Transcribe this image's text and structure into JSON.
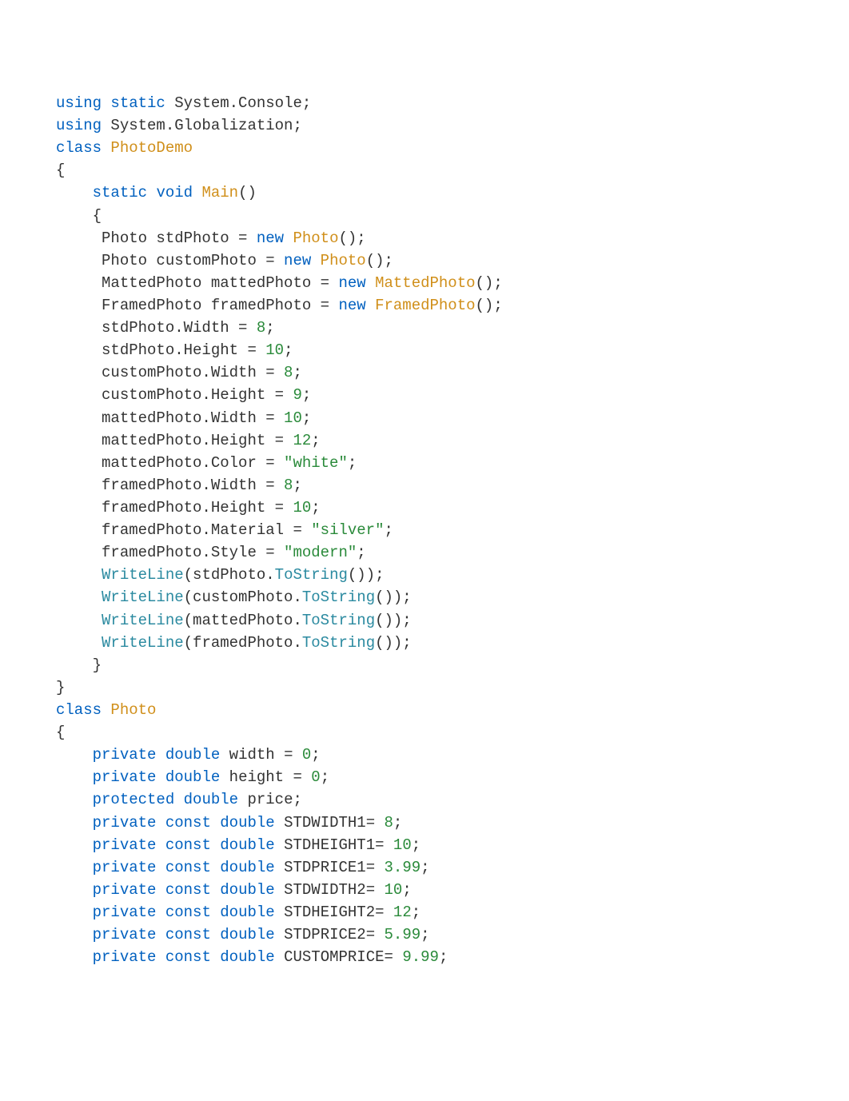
{
  "code": {
    "lines": [
      {
        "segments": [
          {
            "t": "using",
            "c": "kw"
          },
          {
            "t": " ",
            "c": "txt"
          },
          {
            "t": "static",
            "c": "kw"
          },
          {
            "t": " System.Console;",
            "c": "txt"
          }
        ]
      },
      {
        "segments": [
          {
            "t": "using",
            "c": "kw"
          },
          {
            "t": " System.Globalization;",
            "c": "txt"
          }
        ]
      },
      {
        "segments": [
          {
            "t": "class",
            "c": "kw"
          },
          {
            "t": " ",
            "c": "txt"
          },
          {
            "t": "PhotoDemo",
            "c": "type"
          }
        ]
      },
      {
        "segments": [
          {
            "t": "{",
            "c": "txt"
          }
        ]
      },
      {
        "segments": [
          {
            "t": "    ",
            "c": "txt"
          },
          {
            "t": "static",
            "c": "kw"
          },
          {
            "t": " ",
            "c": "txt"
          },
          {
            "t": "void",
            "c": "kw"
          },
          {
            "t": " ",
            "c": "txt"
          },
          {
            "t": "Main",
            "c": "method"
          },
          {
            "t": "()",
            "c": "txt"
          }
        ]
      },
      {
        "segments": [
          {
            "t": "    {",
            "c": "txt"
          }
        ]
      },
      {
        "segments": [
          {
            "t": "     Photo stdPhoto = ",
            "c": "txt"
          },
          {
            "t": "new",
            "c": "kw"
          },
          {
            "t": " ",
            "c": "txt"
          },
          {
            "t": "Photo",
            "c": "type"
          },
          {
            "t": "();",
            "c": "txt"
          }
        ]
      },
      {
        "segments": [
          {
            "t": "     Photo customPhoto = ",
            "c": "txt"
          },
          {
            "t": "new",
            "c": "kw"
          },
          {
            "t": " ",
            "c": "txt"
          },
          {
            "t": "Photo",
            "c": "type"
          },
          {
            "t": "();",
            "c": "txt"
          }
        ]
      },
      {
        "segments": [
          {
            "t": "     MattedPhoto mattedPhoto = ",
            "c": "txt"
          },
          {
            "t": "new",
            "c": "kw"
          },
          {
            "t": " ",
            "c": "txt"
          },
          {
            "t": "MattedPhoto",
            "c": "type"
          },
          {
            "t": "();",
            "c": "txt"
          }
        ]
      },
      {
        "segments": [
          {
            "t": "     FramedPhoto framedPhoto = ",
            "c": "txt"
          },
          {
            "t": "new",
            "c": "kw"
          },
          {
            "t": " ",
            "c": "txt"
          },
          {
            "t": "FramedPhoto",
            "c": "type"
          },
          {
            "t": "();",
            "c": "txt"
          }
        ]
      },
      {
        "segments": [
          {
            "t": "     stdPhoto.Width = ",
            "c": "txt"
          },
          {
            "t": "8",
            "c": "num"
          },
          {
            "t": ";",
            "c": "txt"
          }
        ]
      },
      {
        "segments": [
          {
            "t": "     stdPhoto.Height = ",
            "c": "txt"
          },
          {
            "t": "10",
            "c": "num"
          },
          {
            "t": ";",
            "c": "txt"
          }
        ]
      },
      {
        "segments": [
          {
            "t": "     customPhoto.Width = ",
            "c": "txt"
          },
          {
            "t": "8",
            "c": "num"
          },
          {
            "t": ";",
            "c": "txt"
          }
        ]
      },
      {
        "segments": [
          {
            "t": "     customPhoto.Height = ",
            "c": "txt"
          },
          {
            "t": "9",
            "c": "num"
          },
          {
            "t": ";",
            "c": "txt"
          }
        ]
      },
      {
        "segments": [
          {
            "t": "     mattedPhoto.Width = ",
            "c": "txt"
          },
          {
            "t": "10",
            "c": "num"
          },
          {
            "t": ";",
            "c": "txt"
          }
        ]
      },
      {
        "segments": [
          {
            "t": "     mattedPhoto.Height = ",
            "c": "txt"
          },
          {
            "t": "12",
            "c": "num"
          },
          {
            "t": ";",
            "c": "txt"
          }
        ]
      },
      {
        "segments": [
          {
            "t": "     mattedPhoto.Color = ",
            "c": "txt"
          },
          {
            "t": "\"white\"",
            "c": "str"
          },
          {
            "t": ";",
            "c": "txt"
          }
        ]
      },
      {
        "segments": [
          {
            "t": "     framedPhoto.Width = ",
            "c": "txt"
          },
          {
            "t": "8",
            "c": "num"
          },
          {
            "t": ";",
            "c": "txt"
          }
        ]
      },
      {
        "segments": [
          {
            "t": "     framedPhoto.Height = ",
            "c": "txt"
          },
          {
            "t": "10",
            "c": "num"
          },
          {
            "t": ";",
            "c": "txt"
          }
        ]
      },
      {
        "segments": [
          {
            "t": "     framedPhoto.Material = ",
            "c": "txt"
          },
          {
            "t": "\"silver\"",
            "c": "str"
          },
          {
            "t": ";",
            "c": "txt"
          }
        ]
      },
      {
        "segments": [
          {
            "t": "     framedPhoto.Style = ",
            "c": "txt"
          },
          {
            "t": "\"modern\"",
            "c": "str"
          },
          {
            "t": ";",
            "c": "txt"
          }
        ]
      },
      {
        "segments": [
          {
            "t": "     ",
            "c": "txt"
          },
          {
            "t": "WriteLine",
            "c": "call"
          },
          {
            "t": "(stdPhoto.",
            "c": "txt"
          },
          {
            "t": "ToString",
            "c": "call"
          },
          {
            "t": "());",
            "c": "txt"
          }
        ]
      },
      {
        "segments": [
          {
            "t": "     ",
            "c": "txt"
          },
          {
            "t": "WriteLine",
            "c": "call"
          },
          {
            "t": "(customPhoto.",
            "c": "txt"
          },
          {
            "t": "ToString",
            "c": "call"
          },
          {
            "t": "());",
            "c": "txt"
          }
        ]
      },
      {
        "segments": [
          {
            "t": "     ",
            "c": "txt"
          },
          {
            "t": "WriteLine",
            "c": "call"
          },
          {
            "t": "(mattedPhoto.",
            "c": "txt"
          },
          {
            "t": "ToString",
            "c": "call"
          },
          {
            "t": "());",
            "c": "txt"
          }
        ]
      },
      {
        "segments": [
          {
            "t": "     ",
            "c": "txt"
          },
          {
            "t": "WriteLine",
            "c": "call"
          },
          {
            "t": "(framedPhoto.",
            "c": "txt"
          },
          {
            "t": "ToString",
            "c": "call"
          },
          {
            "t": "());",
            "c": "txt"
          }
        ]
      },
      {
        "segments": [
          {
            "t": "    }",
            "c": "txt"
          }
        ]
      },
      {
        "segments": [
          {
            "t": "}",
            "c": "txt"
          }
        ]
      },
      {
        "segments": [
          {
            "t": "class",
            "c": "kw"
          },
          {
            "t": " ",
            "c": "txt"
          },
          {
            "t": "Photo",
            "c": "type"
          }
        ]
      },
      {
        "segments": [
          {
            "t": "{",
            "c": "txt"
          }
        ]
      },
      {
        "segments": [
          {
            "t": "    ",
            "c": "txt"
          },
          {
            "t": "private",
            "c": "kw"
          },
          {
            "t": " ",
            "c": "txt"
          },
          {
            "t": "double",
            "c": "kw"
          },
          {
            "t": " width = ",
            "c": "txt"
          },
          {
            "t": "0",
            "c": "num"
          },
          {
            "t": ";",
            "c": "txt"
          }
        ]
      },
      {
        "segments": [
          {
            "t": "    ",
            "c": "txt"
          },
          {
            "t": "private",
            "c": "kw"
          },
          {
            "t": " ",
            "c": "txt"
          },
          {
            "t": "double",
            "c": "kw"
          },
          {
            "t": " height = ",
            "c": "txt"
          },
          {
            "t": "0",
            "c": "num"
          },
          {
            "t": ";",
            "c": "txt"
          }
        ]
      },
      {
        "segments": [
          {
            "t": "    ",
            "c": "txt"
          },
          {
            "t": "protected",
            "c": "kw"
          },
          {
            "t": " ",
            "c": "txt"
          },
          {
            "t": "double",
            "c": "kw"
          },
          {
            "t": " price;",
            "c": "txt"
          }
        ]
      },
      {
        "segments": [
          {
            "t": "    ",
            "c": "txt"
          },
          {
            "t": "private",
            "c": "kw"
          },
          {
            "t": " ",
            "c": "txt"
          },
          {
            "t": "const",
            "c": "kw"
          },
          {
            "t": " ",
            "c": "txt"
          },
          {
            "t": "double",
            "c": "kw"
          },
          {
            "t": " STDWIDTH1= ",
            "c": "txt"
          },
          {
            "t": "8",
            "c": "num"
          },
          {
            "t": ";",
            "c": "txt"
          }
        ]
      },
      {
        "segments": [
          {
            "t": "    ",
            "c": "txt"
          },
          {
            "t": "private",
            "c": "kw"
          },
          {
            "t": " ",
            "c": "txt"
          },
          {
            "t": "const",
            "c": "kw"
          },
          {
            "t": " ",
            "c": "txt"
          },
          {
            "t": "double",
            "c": "kw"
          },
          {
            "t": " STDHEIGHT1= ",
            "c": "txt"
          },
          {
            "t": "10",
            "c": "num"
          },
          {
            "t": ";",
            "c": "txt"
          }
        ]
      },
      {
        "segments": [
          {
            "t": "    ",
            "c": "txt"
          },
          {
            "t": "private",
            "c": "kw"
          },
          {
            "t": " ",
            "c": "txt"
          },
          {
            "t": "const",
            "c": "kw"
          },
          {
            "t": " ",
            "c": "txt"
          },
          {
            "t": "double",
            "c": "kw"
          },
          {
            "t": " STDPRICE1= ",
            "c": "txt"
          },
          {
            "t": "3.99",
            "c": "num"
          },
          {
            "t": ";",
            "c": "txt"
          }
        ]
      },
      {
        "segments": [
          {
            "t": "    ",
            "c": "txt"
          },
          {
            "t": "private",
            "c": "kw"
          },
          {
            "t": " ",
            "c": "txt"
          },
          {
            "t": "const",
            "c": "kw"
          },
          {
            "t": " ",
            "c": "txt"
          },
          {
            "t": "double",
            "c": "kw"
          },
          {
            "t": " STDWIDTH2= ",
            "c": "txt"
          },
          {
            "t": "10",
            "c": "num"
          },
          {
            "t": ";",
            "c": "txt"
          }
        ]
      },
      {
        "segments": [
          {
            "t": "    ",
            "c": "txt"
          },
          {
            "t": "private",
            "c": "kw"
          },
          {
            "t": " ",
            "c": "txt"
          },
          {
            "t": "const",
            "c": "kw"
          },
          {
            "t": " ",
            "c": "txt"
          },
          {
            "t": "double",
            "c": "kw"
          },
          {
            "t": " STDHEIGHT2= ",
            "c": "txt"
          },
          {
            "t": "12",
            "c": "num"
          },
          {
            "t": ";",
            "c": "txt"
          }
        ]
      },
      {
        "segments": [
          {
            "t": "    ",
            "c": "txt"
          },
          {
            "t": "private",
            "c": "kw"
          },
          {
            "t": " ",
            "c": "txt"
          },
          {
            "t": "const",
            "c": "kw"
          },
          {
            "t": " ",
            "c": "txt"
          },
          {
            "t": "double",
            "c": "kw"
          },
          {
            "t": " STDPRICE2= ",
            "c": "txt"
          },
          {
            "t": "5.99",
            "c": "num"
          },
          {
            "t": ";",
            "c": "txt"
          }
        ]
      },
      {
        "segments": [
          {
            "t": "    ",
            "c": "txt"
          },
          {
            "t": "private",
            "c": "kw"
          },
          {
            "t": " ",
            "c": "txt"
          },
          {
            "t": "const",
            "c": "kw"
          },
          {
            "t": " ",
            "c": "txt"
          },
          {
            "t": "double",
            "c": "kw"
          },
          {
            "t": " CUSTOMPRICE= ",
            "c": "txt"
          },
          {
            "t": "9.99",
            "c": "num"
          },
          {
            "t": ";",
            "c": "txt"
          }
        ]
      }
    ]
  }
}
